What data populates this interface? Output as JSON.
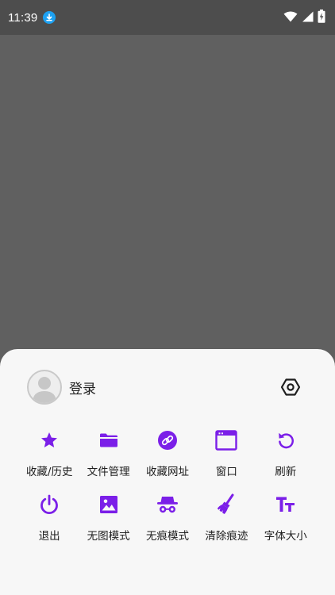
{
  "status_bar": {
    "time": "11:39"
  },
  "sheet": {
    "login_label": "登录",
    "accent_color": "#7b1fe8",
    "items": [
      {
        "label": "收藏/历史",
        "icon": "star-icon"
      },
      {
        "label": "文件管理",
        "icon": "folder-icon"
      },
      {
        "label": "收藏网址",
        "icon": "link-icon"
      },
      {
        "label": "窗口",
        "icon": "window-icon"
      },
      {
        "label": "刷新",
        "icon": "refresh-icon"
      },
      {
        "label": "退出",
        "icon": "power-icon"
      },
      {
        "label": "无图模式",
        "icon": "image-icon"
      },
      {
        "label": "无痕模式",
        "icon": "incognito-icon"
      },
      {
        "label": "清除痕迹",
        "icon": "broom-icon"
      },
      {
        "label": "字体大小",
        "icon": "font-size-icon"
      }
    ]
  }
}
